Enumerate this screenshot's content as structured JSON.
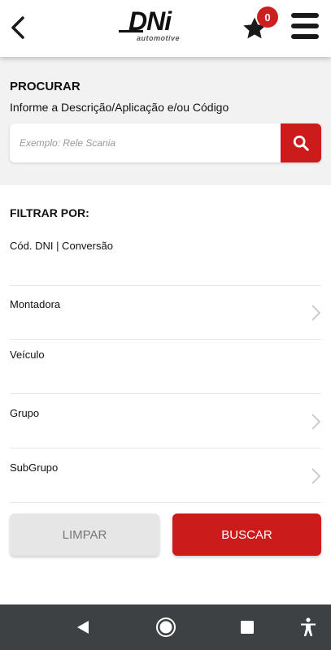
{
  "header": {
    "back_icon": "chevron-left-icon",
    "logo_text": "DNi",
    "logo_subtext": "automotive",
    "favorites_icon": "star-icon",
    "favorites_count": "0",
    "menu_icon": "hamburger-menu-icon"
  },
  "search": {
    "title": "PROCURAR",
    "subtitle": "Informe a Descrição/Aplicação e/ou Código",
    "placeholder": "Exemplo: Rele Scania",
    "button_icon": "search-icon"
  },
  "filters": {
    "title": "FILTRAR POR:",
    "items": [
      {
        "label": "Cód. DNI | Conversão"
      },
      {
        "label": "Montadora"
      },
      {
        "label": "Veículo"
      },
      {
        "label": "Grupo"
      },
      {
        "label": "SubGrupo"
      }
    ]
  },
  "actions": {
    "clear_label": "LIMPAR",
    "search_label": "BUSCAR"
  },
  "colors": {
    "accent": "#cc1b1b",
    "navbar": "#3d4144",
    "section_bg": "#f2f2f2"
  },
  "system_nav": {
    "icons": [
      "back-triangle-icon",
      "home-circle-icon",
      "recents-square-icon",
      "accessibility-icon"
    ]
  }
}
